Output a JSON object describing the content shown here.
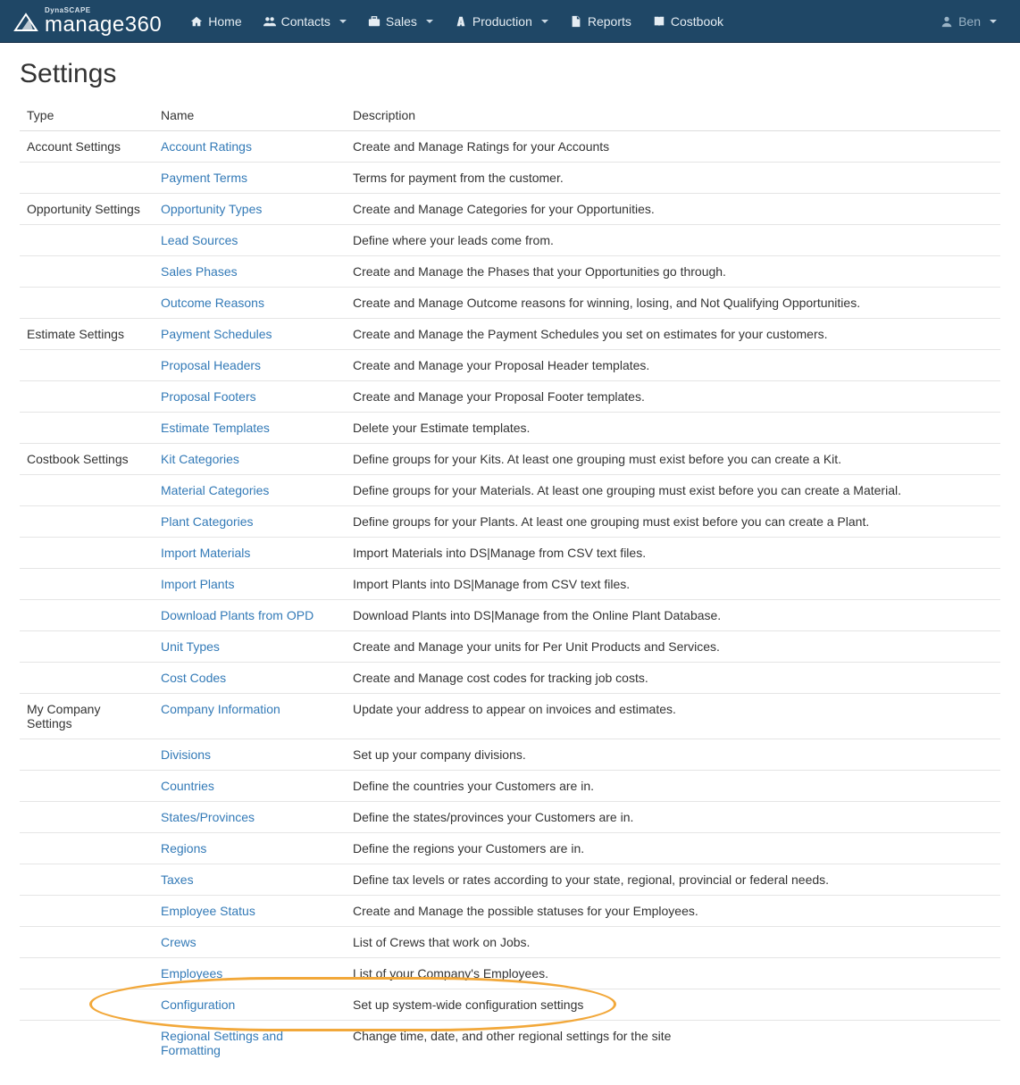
{
  "brand": {
    "tag": "DynaSCAPE",
    "name": "manage360"
  },
  "nav": {
    "items": [
      {
        "icon": "home-icon",
        "label": "Home",
        "caret": false
      },
      {
        "icon": "users-icon",
        "label": "Contacts",
        "caret": true
      },
      {
        "icon": "briefcase-icon",
        "label": "Sales",
        "caret": true
      },
      {
        "icon": "road-icon",
        "label": "Production",
        "caret": true
      },
      {
        "icon": "file-icon",
        "label": "Reports",
        "caret": false
      },
      {
        "icon": "book-icon",
        "label": "Costbook",
        "caret": false
      }
    ],
    "user": {
      "icon": "user-icon",
      "label": "Ben",
      "caret": true
    }
  },
  "page": {
    "title": "Settings",
    "columns": {
      "type": "Type",
      "name": "Name",
      "description": "Description"
    },
    "rows": [
      {
        "type": "Account Settings",
        "name": "Account Ratings",
        "desc": "Create and Manage Ratings for your Accounts"
      },
      {
        "type": "",
        "name": "Payment Terms",
        "desc": "Terms for payment from the customer."
      },
      {
        "type": "Opportunity Settings",
        "name": "Opportunity Types",
        "desc": "Create and Manage Categories for your Opportunities."
      },
      {
        "type": "",
        "name": "Lead Sources",
        "desc": "Define where your leads come from."
      },
      {
        "type": "",
        "name": "Sales Phases",
        "desc": "Create and Manage the Phases that your Opportunities go through."
      },
      {
        "type": "",
        "name": "Outcome Reasons",
        "desc": "Create and Manage Outcome reasons for winning, losing, and Not Qualifying Opportunities."
      },
      {
        "type": "Estimate Settings",
        "name": "Payment Schedules",
        "desc": "Create and Manage the Payment Schedules you set on estimates for your customers."
      },
      {
        "type": "",
        "name": "Proposal Headers",
        "desc": "Create and Manage your Proposal Header templates."
      },
      {
        "type": "",
        "name": "Proposal Footers",
        "desc": "Create and Manage your Proposal Footer templates."
      },
      {
        "type": "",
        "name": "Estimate Templates",
        "desc": "Delete your Estimate templates."
      },
      {
        "type": "Costbook Settings",
        "name": "Kit Categories",
        "desc": "Define groups for your Kits. At least one grouping must exist before you can create a Kit."
      },
      {
        "type": "",
        "name": "Material Categories",
        "desc": "Define groups for your Materials. At least one grouping must exist before you can create a Material."
      },
      {
        "type": "",
        "name": "Plant Categories",
        "desc": "Define groups for your Plants. At least one grouping must exist before you can create a Plant."
      },
      {
        "type": "",
        "name": "Import Materials",
        "desc": "Import Materials into DS|Manage from CSV text files."
      },
      {
        "type": "",
        "name": "Import Plants",
        "desc": "Import Plants into DS|Manage from CSV text files."
      },
      {
        "type": "",
        "name": "Download Plants from OPD",
        "desc": "Download Plants into DS|Manage from the Online Plant Database."
      },
      {
        "type": "",
        "name": "Unit Types",
        "desc": "Create and Manage your units for Per Unit Products and Services."
      },
      {
        "type": "",
        "name": "Cost Codes",
        "desc": "Create and Manage cost codes for tracking job costs."
      },
      {
        "type": "My Company Settings",
        "name": "Company Information",
        "desc": "Update your address to appear on invoices and estimates."
      },
      {
        "type": "",
        "name": "Divisions",
        "desc": "Set up your company divisions."
      },
      {
        "type": "",
        "name": "Countries",
        "desc": "Define the countries your Customers are in."
      },
      {
        "type": "",
        "name": "States/Provinces",
        "desc": "Define the states/provinces your Customers are in."
      },
      {
        "type": "",
        "name": "Regions",
        "desc": "Define the regions your Customers are in."
      },
      {
        "type": "",
        "name": "Taxes",
        "desc": "Define tax levels or rates according to your state, regional, provincial or federal needs."
      },
      {
        "type": "",
        "name": "Employee Status",
        "desc": "Create and Manage the possible statuses for your Employees."
      },
      {
        "type": "",
        "name": "Crews",
        "desc": "List of Crews that work on Jobs."
      },
      {
        "type": "",
        "name": "Employees",
        "desc": "List of your Company's Employees."
      },
      {
        "type": "",
        "name": "Configuration",
        "desc": "Set up system-wide configuration settings",
        "highlight": true
      },
      {
        "type": "",
        "name": "Regional Settings and Formatting",
        "desc": "Change time, date, and other regional settings for the site"
      }
    ]
  }
}
